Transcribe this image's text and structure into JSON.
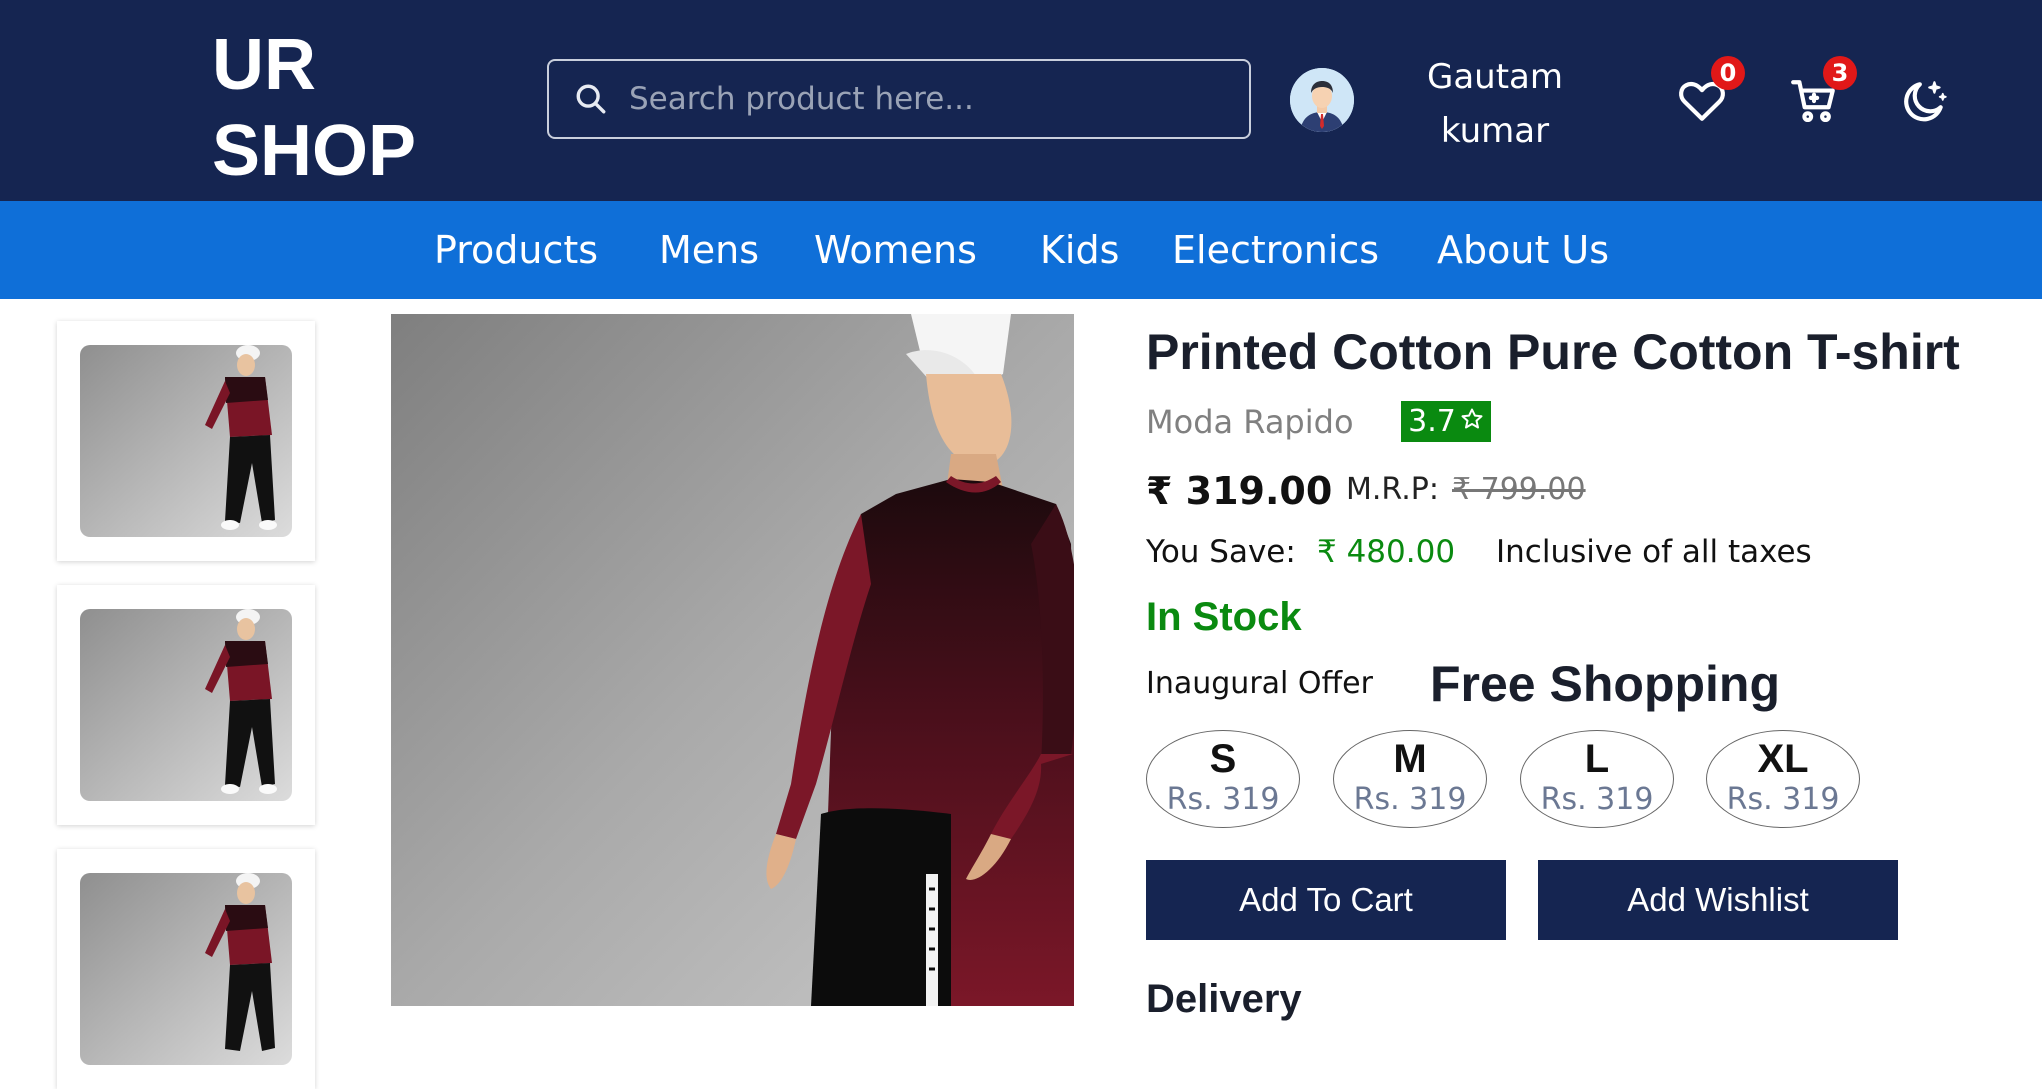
{
  "header": {
    "logo_line1": "UR",
    "logo_line2": "SHOP",
    "search_placeholder": "Search product here...",
    "user_first": "Gautam",
    "user_last": "kumar",
    "wishlist_count": "0",
    "cart_count": "3"
  },
  "nav": {
    "items": [
      "Products",
      "Mens",
      "Womens",
      "Kids",
      "Electronics",
      "About Us"
    ]
  },
  "product": {
    "title": "Printed Cotton Pure Cotton T-shirt",
    "brand": "Moda Rapido",
    "rating": "3.7",
    "price": "₹ 319.00",
    "mrp_label": "M.R.P:",
    "mrp": "₹ 799.00",
    "save_label": "You Save:",
    "save_value": "₹ 480.00",
    "taxes": "Inclusive of all taxes",
    "stock": "In Stock",
    "offer_label": "Inaugural Offer",
    "offer_value": "Free Shopping",
    "sizes": [
      {
        "label": "S",
        "price": "Rs. 319"
      },
      {
        "label": "M",
        "price": "Rs. 319"
      },
      {
        "label": "L",
        "price": "Rs. 319"
      },
      {
        "label": "XL",
        "price": "Rs. 319"
      }
    ],
    "add_to_cart": "Add To Cart",
    "add_wishlist": "Add Wishlist",
    "delivery_heading": "Delivery"
  },
  "colors": {
    "header_bg": "#152551",
    "nav_bg": "#0f6fd8",
    "in_stock": "#0a8a10",
    "badge": "#e11818"
  },
  "icons": [
    "search-icon",
    "user-avatar",
    "heart-icon",
    "cart-icon",
    "moon-icon",
    "star-icon"
  ]
}
